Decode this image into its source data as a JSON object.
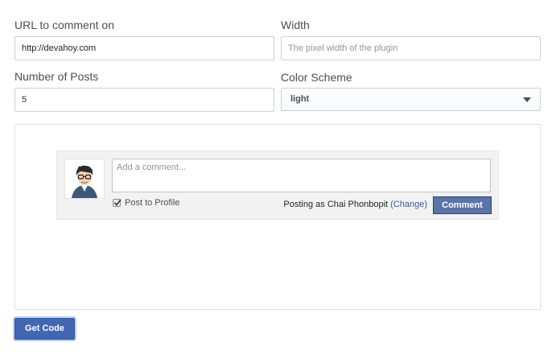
{
  "form": {
    "url": {
      "label": "URL to comment on",
      "value": "http://devahoy.com"
    },
    "width": {
      "label": "Width",
      "placeholder": "The pixel width of the plugin"
    },
    "num_posts": {
      "label": "Number of Posts",
      "value": "5"
    },
    "color_scheme": {
      "label": "Color Scheme",
      "selected": "light"
    }
  },
  "preview": {
    "comment_placeholder": "Add a comment...",
    "post_to_profile_label": "Post to Profile",
    "post_to_profile_checked": true,
    "posting_as_prefix": "Posting as Chai Phonbopit",
    "change_link": "(Change)",
    "comment_button": "Comment",
    "avatar_icon": "user-avatar-icon"
  },
  "actions": {
    "get_code": "Get Code"
  },
  "colors": {
    "primary_button": "#4267b2",
    "comment_button": "#5b74a8",
    "link": "#3b5998"
  }
}
